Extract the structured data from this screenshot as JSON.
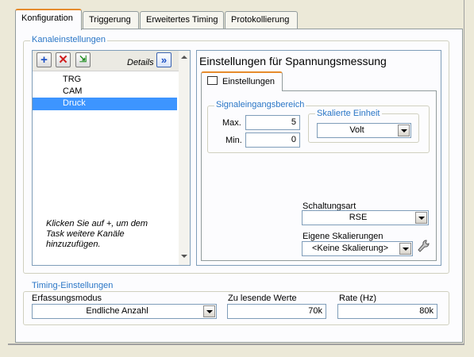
{
  "tabs": [
    "Konfiguration",
    "Triggerung",
    "Erweitertes Timing",
    "Protokollierung"
  ],
  "channel_settings": {
    "title": "Kanaleinstellungen",
    "details_label": "Details",
    "channels": [
      "TRG",
      "CAM",
      "Druck"
    ],
    "selected_channel": "Druck",
    "hint": "Klicken Sie auf +, um dem Task weitere Kanäle hinzuzufügen.",
    "heading": "Einstellungen für Spannungsmessung",
    "inner_tab": "Einstellungen",
    "signal_range": {
      "title": "Signaleingangsbereich",
      "max_label": "Max.",
      "max_value": "5",
      "min_label": "Min.",
      "min_value": "0"
    },
    "scaled_unit": {
      "title": "Skalierte Einheit",
      "value": "Volt"
    },
    "wiring": {
      "label": "Schaltungsart",
      "value": "RSE"
    },
    "custom_scaling": {
      "label": "Eigene Skalierungen",
      "value": "<Keine Skalierung>"
    }
  },
  "timing": {
    "title": "Timing-Einstellungen",
    "mode_label": "Erfassungsmodus",
    "mode_value": "Endliche Anzahl",
    "samples_label": "Zu lesende Werte",
    "samples_value": "70k",
    "rate_label": "Rate (Hz)",
    "rate_value": "80k"
  },
  "colors": {
    "accent": "#2a76c6",
    "selection": "#3d95ff",
    "tab_highlight": "#e68b2c"
  }
}
